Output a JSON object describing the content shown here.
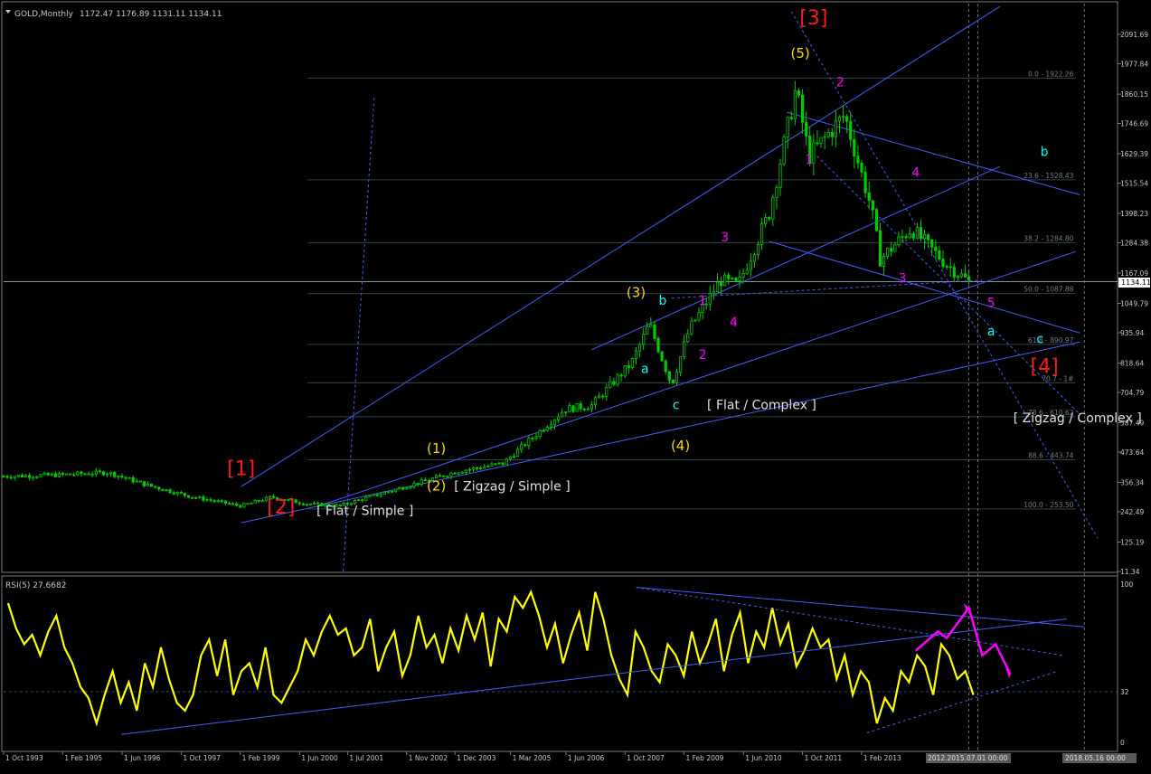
{
  "window": {
    "title": "GOLD,Monthly",
    "ohlc": "1172.47 1176.89 1131.11 1134.11",
    "rsi_title": "RSI(5) 27.6682"
  },
  "colors": {
    "background": "#000000",
    "candle": "#00cc00",
    "rsi_line": "#ffff00",
    "trendline": "#3f5fff",
    "grid": "#34424a",
    "wave_major": "#ff1a1a",
    "wave_intermediate": "#ffd700",
    "wave_minor": "#ff00ff",
    "wave_abc": "#00ffff",
    "text": "#c8c8c8"
  },
  "chart_data": [
    {
      "type": "candlestick",
      "title": "GOLD,Monthly",
      "symbol": "GOLD",
      "timeframe": "Monthly",
      "last_ohlc": {
        "open": 1172.47,
        "high": 1176.89,
        "low": 1131.11,
        "close": 1134.11
      },
      "current_price": "1134.11",
      "ylim": [
        11.34,
        2150
      ],
      "y_ticks": [
        "2091.69",
        "1977.84",
        "1860.15",
        "1746.69",
        "1629.39",
        "1515.54",
        "1398.23",
        "1284.38",
        "1167.09",
        "1049.79",
        "935.94",
        "818.64",
        "704.79",
        "587.49",
        "473.64",
        "356.34",
        "242.49",
        "125.19",
        "11.34"
      ],
      "x_ticks": [
        "1 Oct 1993",
        "1 Feb 1995",
        "1 Jun 1996",
        "1 Oct 1997",
        "1 Feb 1999",
        "1 Jun 2000",
        "1 Jul 2001",
        "1 Nov 2002",
        "1 Dec 2003",
        "1 Mar 2005",
        "1 Jun 2006",
        "1 Oct 2007",
        "1 Feb 2009",
        "1 Jun 2010",
        "1 Oct 2011",
        "1 Feb 2013"
      ],
      "cursor_labels": [
        "2012.2015.07.01 00:00",
        "2018.05.16 00:00"
      ],
      "price_path": [
        {
          "x": 1993.75,
          "y": 380
        },
        {
          "x": 1995.0,
          "y": 385
        },
        {
          "x": 1996.1,
          "y": 395
        },
        {
          "x": 1997.0,
          "y": 345
        },
        {
          "x": 1998.0,
          "y": 300
        },
        {
          "x": 1999.1,
          "y": 265
        },
        {
          "x": 1999.8,
          "y": 300
        },
        {
          "x": 2000.5,
          "y": 275
        },
        {
          "x": 2001.3,
          "y": 265
        },
        {
          "x": 2002.0,
          "y": 300
        },
        {
          "x": 2003.0,
          "y": 350
        },
        {
          "x": 2004.0,
          "y": 400
        },
        {
          "x": 2005.0,
          "y": 430
        },
        {
          "x": 2006.4,
          "y": 640
        },
        {
          "x": 2007.0,
          "y": 655
        },
        {
          "x": 2007.9,
          "y": 820
        },
        {
          "x": 2008.3,
          "y": 970
        },
        {
          "x": 2008.8,
          "y": 735
        },
        {
          "x": 2009.2,
          "y": 950
        },
        {
          "x": 2009.9,
          "y": 1140
        },
        {
          "x": 2010.3,
          "y": 1120
        },
        {
          "x": 2011.0,
          "y": 1400
        },
        {
          "x": 2011.6,
          "y": 1880
        },
        {
          "x": 2011.9,
          "y": 1620
        },
        {
          "x": 2012.7,
          "y": 1780
        },
        {
          "x": 2013.3,
          "y": 1420
        },
        {
          "x": 2013.5,
          "y": 1220
        },
        {
          "x": 2014.2,
          "y": 1340
        },
        {
          "x": 2015.0,
          "y": 1200
        },
        {
          "x": 2015.5,
          "y": 1134
        }
      ],
      "fibonacci_levels": [
        {
          "label": "0.0 - 1922.26",
          "value": 1922.26
        },
        {
          "label": "23.6 - 1528.43",
          "value": 1528.43
        },
        {
          "label": "38.2 - 1284.80",
          "value": 1284.8
        },
        {
          "label": "50.0 - 1087.88",
          "value": 1087.88
        },
        {
          "label": "61.8 - 890.97",
          "value": 890.97
        },
        {
          "label": "70.7 - 1#",
          "value": 742
        },
        {
          "label": "78.6 - 610.62",
          "value": 610.62
        },
        {
          "label": "88.6 - 443.74",
          "value": 443.74
        },
        {
          "label": "100.0 - 253.50",
          "value": 253.5
        }
      ],
      "annotations": {
        "major": [
          {
            "text": "[1]",
            "x": 1999.1,
            "y": 385
          },
          {
            "text": "[2]",
            "x": 2000.0,
            "y": 235
          },
          {
            "text": "[3]",
            "x": 2012.0,
            "y": 2130
          },
          {
            "text": "[4]",
            "x": 2017.2,
            "y": 780
          }
        ],
        "intermediate": [
          {
            "text": "(1)",
            "x": 2003.5,
            "y": 470
          },
          {
            "text": "(2)",
            "x": 2003.5,
            "y": 325
          },
          {
            "text": "(3)",
            "x": 2008.0,
            "y": 1075
          },
          {
            "text": "(4)",
            "x": 2009.0,
            "y": 480
          },
          {
            "text": "(5)",
            "x": 2011.7,
            "y": 2000
          }
        ],
        "minor": [
          {
            "text": "1",
            "x": 2009.5,
            "y": 1045
          },
          {
            "text": "2",
            "x": 2009.5,
            "y": 835
          },
          {
            "text": "3",
            "x": 2010.0,
            "y": 1290
          },
          {
            "text": "4",
            "x": 2010.2,
            "y": 960
          },
          {
            "text": "1",
            "x": 2011.9,
            "y": 1590
          },
          {
            "text": "2",
            "x": 2012.6,
            "y": 1890
          },
          {
            "text": "3",
            "x": 2014.0,
            "y": 1130
          },
          {
            "text": "4",
            "x": 2014.3,
            "y": 1540
          },
          {
            "text": "5",
            "x": 2016.0,
            "y": 1035
          }
        ],
        "abc": [
          {
            "text": "a",
            "x": 2008.2,
            "y": 780
          },
          {
            "text": "b",
            "x": 2008.6,
            "y": 1045
          },
          {
            "text": "c",
            "x": 2008.9,
            "y": 640
          },
          {
            "text": "a",
            "x": 2016.0,
            "y": 925
          },
          {
            "text": "b",
            "x": 2017.2,
            "y": 1620
          },
          {
            "text": "c",
            "x": 2017.1,
            "y": 895
          }
        ],
        "structure": [
          {
            "text": "[ Flat / Simple ]",
            "x": 2000.8,
            "y": 230
          },
          {
            "text": "[ Zigzag / Simple ]",
            "x": 2003.9,
            "y": 325
          },
          {
            "text": "[ Flat / Complex ]",
            "x": 2009.6,
            "y": 640
          },
          {
            "text": "[ Zigzag / Complex ]",
            "x": 2016.5,
            "y": 590
          }
        ]
      }
    },
    {
      "type": "line",
      "title": "RSI(5) 27.6682",
      "series": [
        {
          "name": "RSI(5)",
          "last_value": 27.6682,
          "values": [
            88,
            72,
            62,
            68,
            55,
            70,
            80,
            60,
            50,
            35,
            28,
            12,
            30,
            45,
            25,
            38,
            20,
            50,
            35,
            60,
            40,
            25,
            20,
            30,
            55,
            65,
            42,
            65,
            30,
            45,
            50,
            35,
            60,
            30,
            25,
            35,
            45,
            65,
            55,
            70,
            80,
            68,
            72,
            55,
            60,
            78,
            45,
            60,
            70,
            42,
            55,
            80,
            60,
            68,
            50,
            72,
            58,
            80,
            65,
            82,
            48,
            78,
            70,
            92,
            85,
            95,
            80,
            60,
            75,
            50,
            68,
            82,
            58,
            95,
            78,
            55,
            40,
            30,
            70,
            60,
            45,
            38,
            62,
            55,
            42,
            70,
            50,
            62,
            78,
            45,
            68,
            82,
            50,
            70,
            60,
            85,
            62,
            75,
            48,
            58,
            72,
            60,
            65,
            40,
            55,
            30,
            45,
            38,
            12,
            28,
            20,
            45,
            38,
            55,
            48,
            30,
            62,
            55,
            40,
            45,
            30
          ]
        }
      ],
      "ylim": [
        0,
        100
      ],
      "y_ticks": [
        "100",
        "32",
        "0"
      ],
      "level": 32
    }
  ]
}
